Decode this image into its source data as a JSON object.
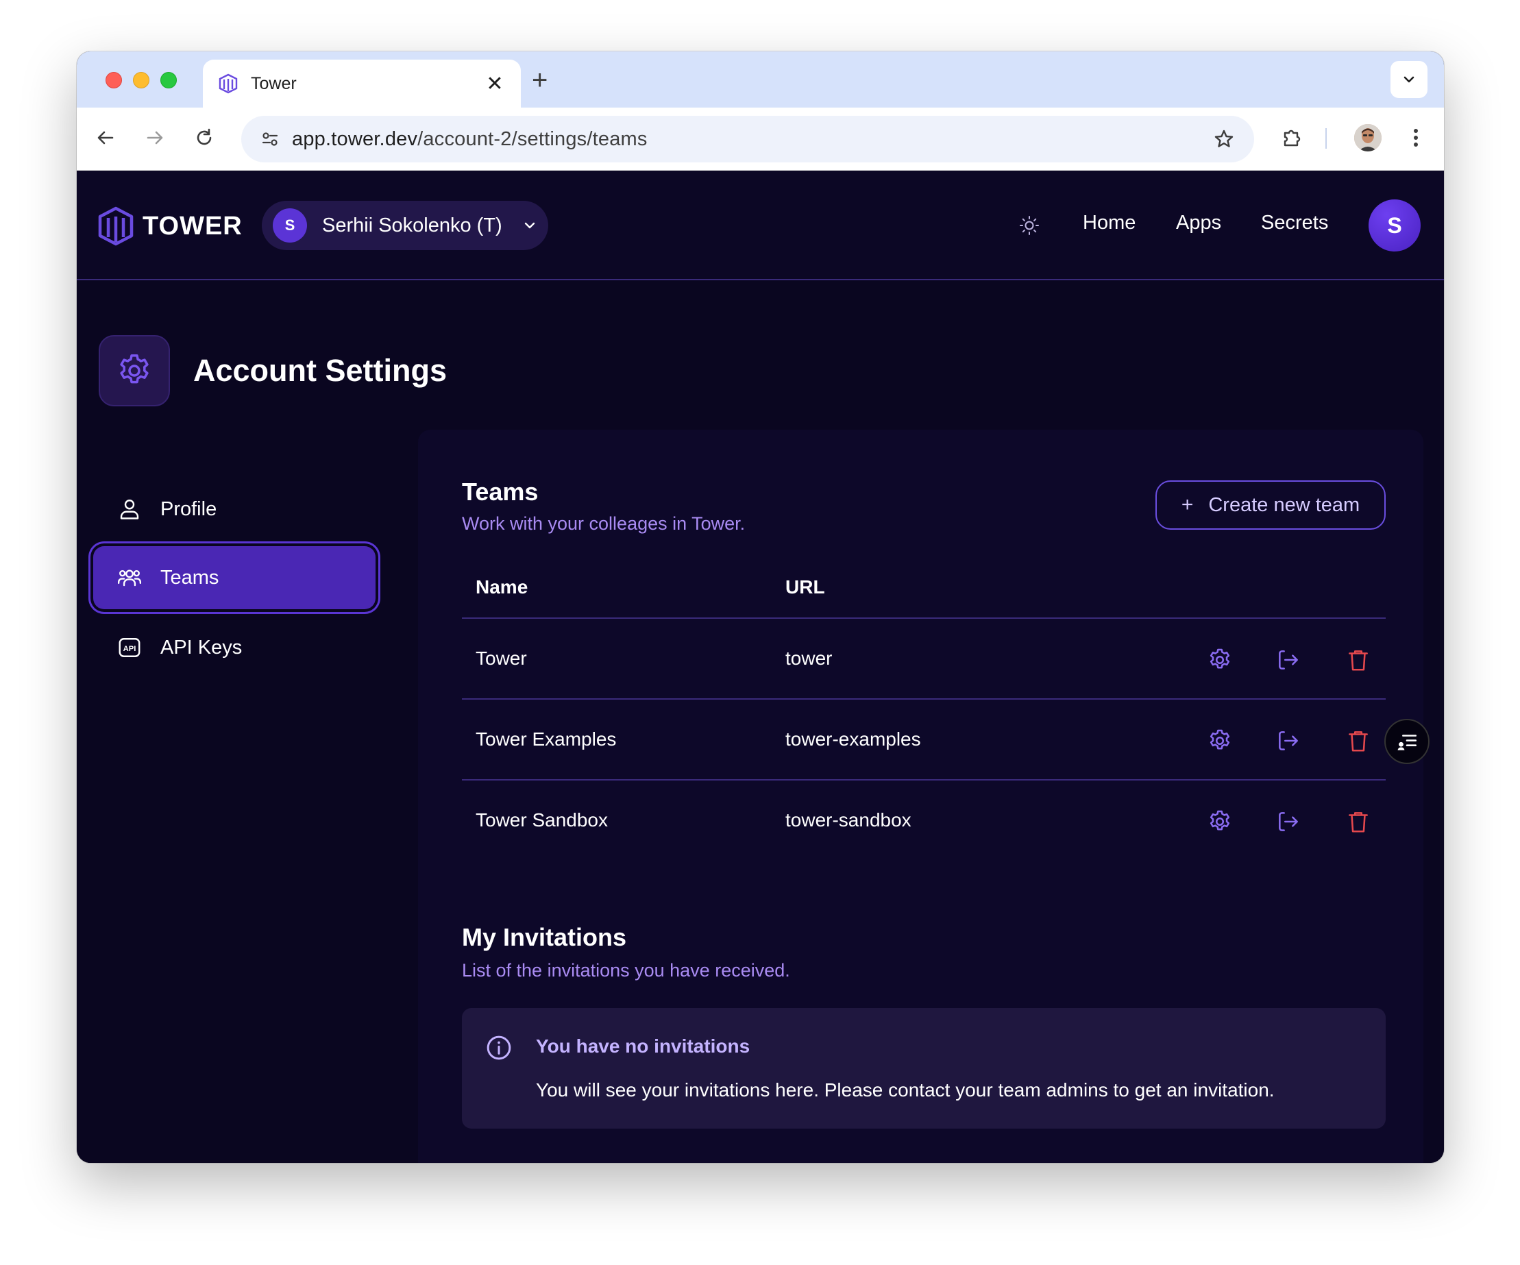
{
  "browser": {
    "tab_title": "Tower",
    "url_host": "app.tower.dev",
    "url_path": "/account-2/settings/teams",
    "new_tab_glyph": "+",
    "close_glyph": "✕"
  },
  "header": {
    "logo_text": "TOWER",
    "account_initial": "S",
    "account_name": "Serhii Sokolenko (T)",
    "nav": [
      "Home",
      "Apps",
      "Secrets"
    ],
    "user_initial": "S"
  },
  "settings": {
    "title": "Account Settings",
    "sidebar": [
      {
        "label": "Profile",
        "icon": "user-icon",
        "active": false
      },
      {
        "label": "Teams",
        "icon": "users-icon",
        "active": true
      },
      {
        "label": "API Keys",
        "icon": "api-icon",
        "active": false
      }
    ]
  },
  "teams": {
    "title": "Teams",
    "subtitle": "Work with your colleages in Tower.",
    "create_button": "Create new team",
    "columns": [
      "Name",
      "URL"
    ],
    "rows": [
      {
        "name": "Tower",
        "url": "tower"
      },
      {
        "name": "Tower Examples",
        "url": "tower-examples"
      },
      {
        "name": "Tower Sandbox",
        "url": "tower-sandbox"
      }
    ],
    "row_actions": [
      "gear-icon",
      "leave-icon",
      "trash-icon"
    ]
  },
  "invitations": {
    "title": "My Invitations",
    "subtitle": "List of the invitations you have received.",
    "alert_title": "You have no invitations",
    "alert_body": "You will see your invitations here. Please contact your team admins to get an invitation."
  },
  "colors": {
    "background": "#0a0620",
    "accent": "#4a27b4",
    "accent_text": "#a98bf2",
    "danger": "#e5484d"
  }
}
